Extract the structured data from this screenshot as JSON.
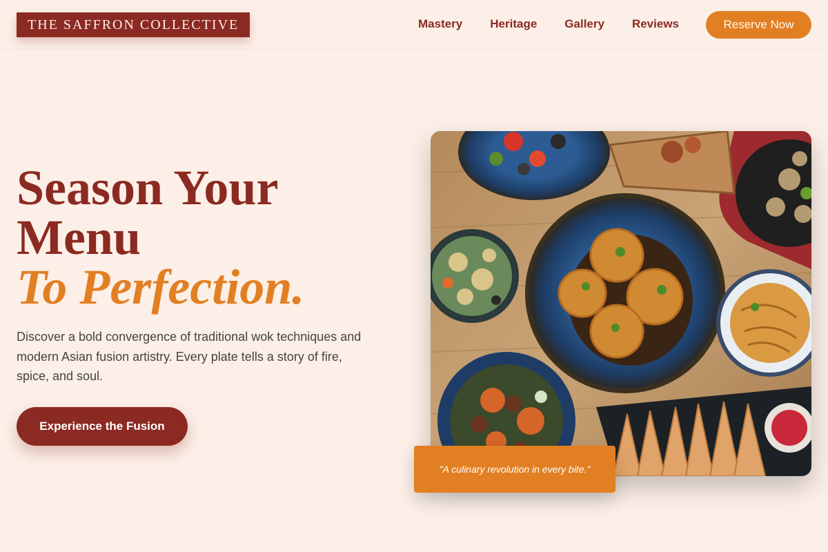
{
  "brand": {
    "name": "THE SAFFRON COLLECTIVE"
  },
  "nav": {
    "items": [
      {
        "label": "Mastery"
      },
      {
        "label": "Heritage"
      },
      {
        "label": "Gallery"
      },
      {
        "label": "Reviews"
      }
    ],
    "reserve_label": "Reserve Now"
  },
  "hero": {
    "headline_line1": "Season Your",
    "headline_line2": "Menu",
    "headline_accent": "To Perfection.",
    "description": "Discover a bold convergence of traditional wok techniques and modern Asian fusion artistry. Every plate tells a story of fire, spice, and soul.",
    "cta_label": "Experience the Fusion",
    "quote": "\"A culinary revolution in every bite.\""
  },
  "colors": {
    "background": "#fbefe7",
    "brand": "#8b2a22",
    "accent": "#e27f23"
  }
}
